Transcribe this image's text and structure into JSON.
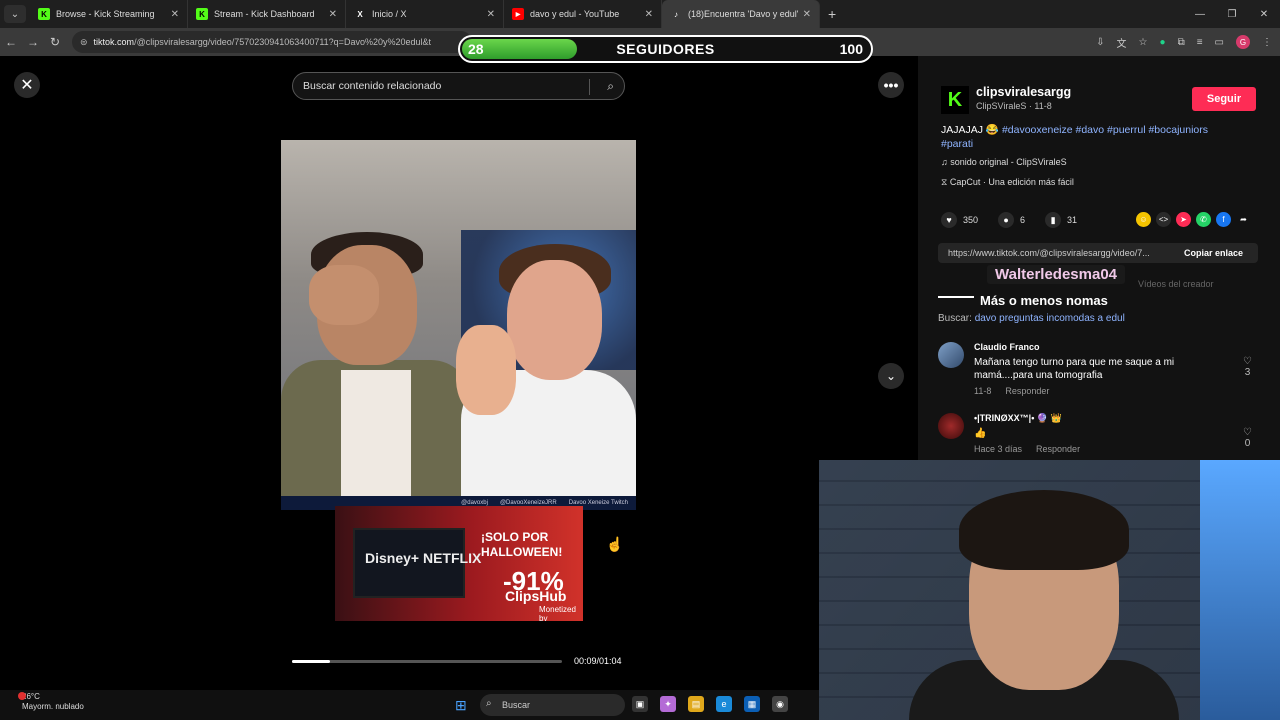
{
  "browser": {
    "tabs": [
      {
        "title": "Browse - Kick Streaming",
        "fav": "K",
        "fav_color": "#53fc18"
      },
      {
        "title": "Stream - Kick Dashboard",
        "fav": "K",
        "fav_color": "#53fc18"
      },
      {
        "title": "Inicio / X",
        "fav": "X",
        "fav_color": "#ffffff"
      },
      {
        "title": "davo y edul - YouTube",
        "fav": "▶",
        "fav_color": "#ff0000"
      },
      {
        "title": "(18)Encuentra 'Davo y edul'",
        "fav": "♪",
        "fav_color": "#ffffff"
      }
    ],
    "url_host": "tiktok.com",
    "url_path": "/@clipsviralesargg/video/7570230941063400711?q=Davo%20y%20edul&t"
  },
  "overlay": {
    "followers_current": "28",
    "followers_label": "SEGUIDORES",
    "followers_goal": "100",
    "fill_fraction": 0.28
  },
  "player": {
    "search_placeholder": "Buscar contenido relacionado",
    "socials": [
      "@davoxbj",
      "@DavooXeneizeJRR",
      "Davoo Xeneize Twitch"
    ],
    "ad": {
      "brands": "Disney+ NETFLIX",
      "promo": "¡SOLO POR HALLOWEEN!",
      "percent": "-91%",
      "brand": "ClipsHub",
      "monetized": "Monetized by"
    },
    "time": "00:09/01:04",
    "progress_fraction": 0.14
  },
  "panel": {
    "username": "clipsviralesargg",
    "meta": "ClipSViraleS · 11-8",
    "follow_label": "Seguir",
    "caption_text": "JAJAJAJ 😂",
    "caption_tags": "#davooxeneize #davo #puerrul #bocajuniors #parati",
    "music": "sonido original - ClipSViraleS",
    "capcut": "CapCut · Una edición más fácil",
    "likes": "350",
    "comments": "6",
    "saves": "31",
    "link": "https://www.tiktok.com/@clipsviralesargg/video/7...",
    "copy_link": "Copiar enlace",
    "creator_videos": "Vídeos del creador",
    "search_label": "Buscar:",
    "search_query": "davo preguntas incomodas a edul",
    "comment_list": [
      {
        "name": "Claudio Franco",
        "text": "Mañana tengo turno para que me saque a mi mamá....para una tomografia",
        "date": "11-8",
        "reply": "Responder",
        "likes": "3"
      },
      {
        "name": "•|TRINØXX™|• 🔮 👑",
        "text": "👍",
        "date": "Hace 3 días",
        "reply": "Responder",
        "likes": "0"
      }
    ]
  },
  "chat_overlay": {
    "user": "Walterledesma04",
    "message": "Más o menos nomas"
  },
  "taskbar": {
    "temp": "26°C",
    "weather": "Mayorm. nublado",
    "search": "Buscar"
  }
}
